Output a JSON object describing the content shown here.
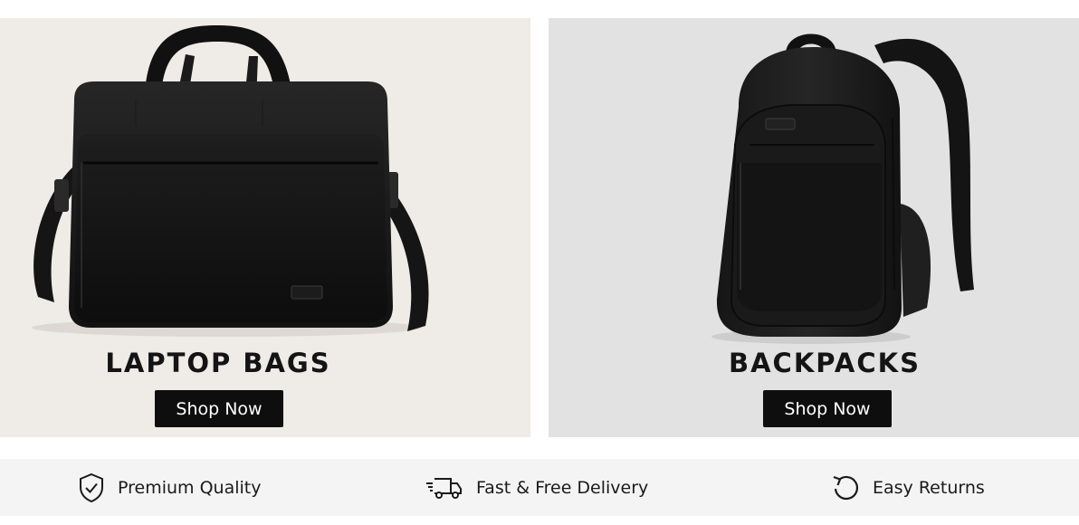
{
  "products": [
    {
      "title": "LAPTOP BAGS",
      "button_label": "Shop Now",
      "image_icon": "laptop-bag-image",
      "background": "#efebe6"
    },
    {
      "title": "BACKPACKS",
      "button_label": "Shop Now",
      "image_icon": "backpack-image",
      "background": "#e2e2e2"
    }
  ],
  "features": [
    {
      "label": "Premium Quality",
      "icon": "shield-check-icon"
    },
    {
      "label": "Fast & Free Delivery",
      "icon": "delivery-truck-icon"
    },
    {
      "label": "Easy Returns",
      "icon": "returns-icon"
    }
  ],
  "colors": {
    "button_bg": "#0e0e0e",
    "button_text": "#ffffff",
    "feature_bar_bg": "#f4f4f4",
    "text": "#141414"
  }
}
